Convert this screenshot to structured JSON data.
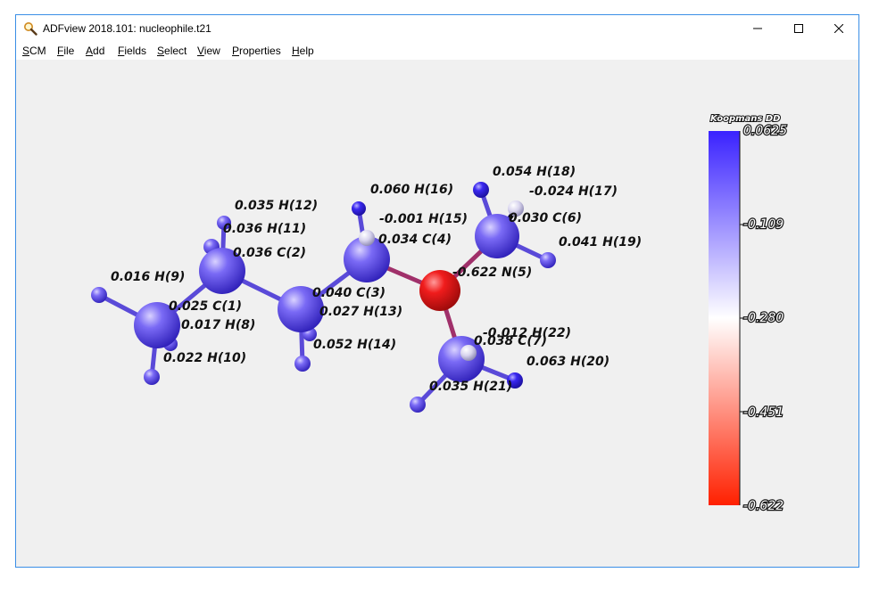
{
  "window": {
    "title": "ADFview 2018.101: nucleophile.t21",
    "controls": {
      "minimize": "—",
      "maximize": "☐",
      "close": "✕"
    }
  },
  "menu": [
    {
      "first": "S",
      "rest": "CM"
    },
    {
      "first": "F",
      "rest": "ile"
    },
    {
      "first": "A",
      "rest": "dd"
    },
    {
      "first": "F",
      "rest": "ields"
    },
    {
      "first": "S",
      "rest": "elect"
    },
    {
      "first": "V",
      "rest": "iew"
    },
    {
      "first": "P",
      "rest": "roperties"
    },
    {
      "first": "H",
      "rest": "elp"
    }
  ],
  "colorbar": {
    "title": "Koopmans DD",
    "ticks": [
      "0.0625",
      "-0.109",
      "-0.280",
      "-0.451",
      "-0.622"
    ],
    "colors": {
      "top": "#3a22ff",
      "mid": "#ffffff",
      "bottom": "#ff2000"
    }
  },
  "atoms": {
    "c1": "0.025 C(1)",
    "c2": "0.036 C(2)",
    "c3": "0.040 C(3)",
    "c4": "0.034 C(4)",
    "n5": "-0.622 N(5)",
    "c6": "0.030 C(6)",
    "c7": "0.038 C(7)",
    "h8": "0.017 H(8)",
    "h9": "0.016 H(9)",
    "h10": "0.022 H(10)",
    "h11": "0.036 H(11)",
    "h12": "0.035 H(12)",
    "h13": "0.027 H(13)",
    "h14": "0.052 H(14)",
    "h15": "-0.001 H(15)",
    "h16": "0.060 H(16)",
    "h17": "-0.024 H(17)",
    "h18": "0.054 H(18)",
    "h19": "0.041 H(19)",
    "h20": "0.063 H(20)",
    "h21": "0.035 H(21)",
    "h22": "-0.012 H(22)"
  }
}
